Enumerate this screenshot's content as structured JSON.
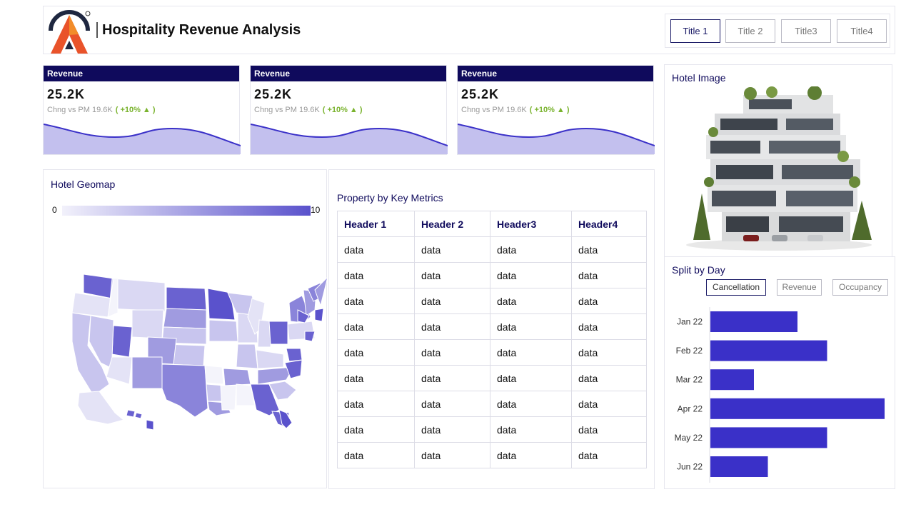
{
  "header": {
    "title": "Hospitality Revenue Analysis",
    "tabs": [
      "Title 1",
      "Title 2",
      "Title3",
      "Title4"
    ],
    "active_tab": 0
  },
  "kpis": [
    {
      "label": "Revenue",
      "value": "25.2K",
      "change_text": "Chng vs PM 19.6K",
      "change_pct": "( +10% ▲ )"
    },
    {
      "label": "Revenue",
      "value": "25.2K",
      "change_text": "Chng vs PM 19.6K",
      "change_pct": "( +10% ▲ )"
    },
    {
      "label": "Revenue",
      "value": "25.2K",
      "change_text": "Chng vs PM 19.6K",
      "change_pct": "( +10% ▲ )"
    }
  ],
  "geomap": {
    "title": "Hotel Geomap",
    "legend_min": "0",
    "legend_max": "10"
  },
  "table": {
    "title": "Property by Key Metrics",
    "headers": [
      "Header 1",
      "Header 2",
      "Header3",
      "Header4"
    ],
    "rows": [
      [
        "data",
        "data",
        "data",
        "data"
      ],
      [
        "data",
        "data",
        "data",
        "data"
      ],
      [
        "data",
        "data",
        "data",
        "data"
      ],
      [
        "data",
        "data",
        "data",
        "data"
      ],
      [
        "data",
        "data",
        "data",
        "data"
      ],
      [
        "data",
        "data",
        "data",
        "data"
      ],
      [
        "data",
        "data",
        "data",
        "data"
      ],
      [
        "data",
        "data",
        "data",
        "data"
      ],
      [
        "data",
        "data",
        "data",
        "data"
      ]
    ]
  },
  "hotel_image": {
    "title": "Hotel Image"
  },
  "split": {
    "title": "Split by Day",
    "buttons": [
      "Cancellation",
      "Revenue",
      "Occupancy"
    ],
    "active_button": 0
  },
  "colors": {
    "navy": "#0f0a5c",
    "bar": "#3a30c8",
    "area_fill": "#c3c0ee",
    "area_line": "#3a30c8",
    "positive": "#7ab32e"
  },
  "chart_data": {
    "type": "bar",
    "orientation": "horizontal",
    "categories": [
      "Jan 22",
      "Feb 22",
      "Mar 22",
      "Apr 22",
      "May 22",
      "Jun 22"
    ],
    "values": [
      5,
      6.7,
      2.5,
      10,
      6.7,
      3.3
    ],
    "xlim": [
      0,
      10
    ]
  }
}
